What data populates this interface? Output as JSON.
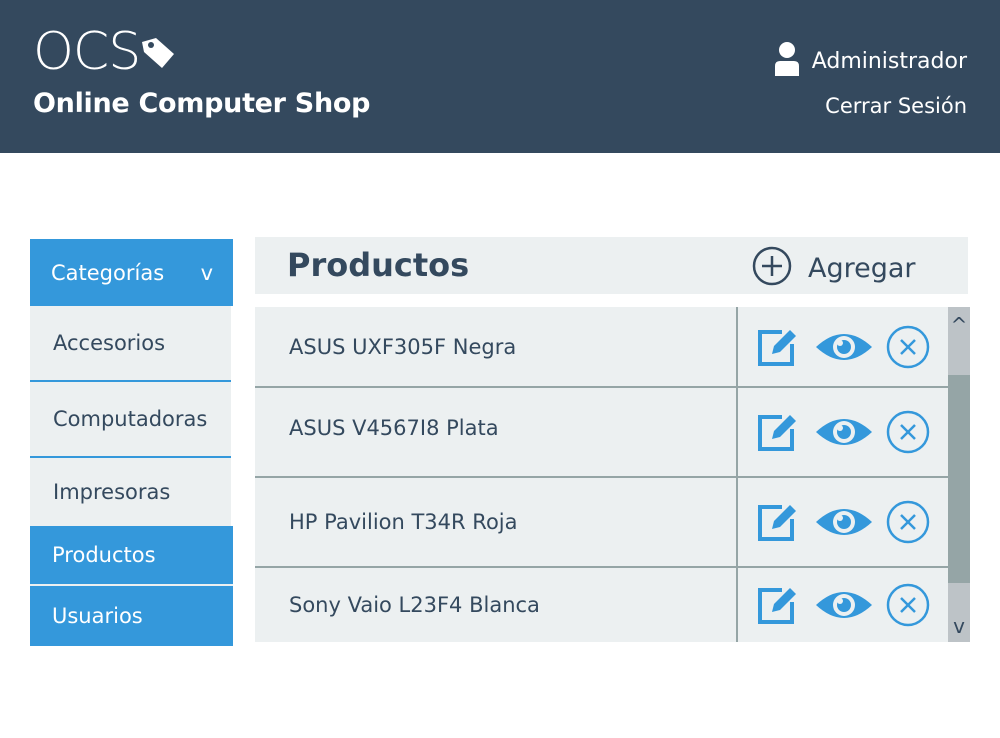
{
  "header": {
    "logo_text": "OCS",
    "shop_name": "Online Computer Shop",
    "user_name": "Administrador",
    "logout_label": "Cerrar Sesión",
    "background": "#34495e"
  },
  "sidebar": {
    "header_label": "Categorías",
    "toggle_glyph": "v",
    "items": [
      {
        "label": "Accesorios",
        "active": false
      },
      {
        "label": "Computadoras",
        "active": false
      },
      {
        "label": "Impresoras",
        "active": false
      },
      {
        "label": "Productos",
        "active": true
      },
      {
        "label": "Usuarios",
        "active": true
      }
    ]
  },
  "content": {
    "title": "Productos",
    "add_label": "Agregar"
  },
  "products": [
    {
      "name": "ASUS UXF305F Negra"
    },
    {
      "name": "ASUS V4567I8 Plata"
    },
    {
      "name": "HP Pavilion T34R Roja"
    },
    {
      "name": "Sony Vaio L23F4 Blanca"
    }
  ],
  "scrollbar": {
    "up_glyph": "^",
    "down_glyph": "v"
  },
  "colors": {
    "accent": "#3498db",
    "dark": "#34495e",
    "light": "#ecf0f1",
    "divider": "#95a5a6"
  },
  "icons": {
    "logo_tag": "price-tag-icon",
    "user": "user-icon",
    "add": "plus-circle-icon",
    "edit": "edit-icon",
    "view": "eye-icon",
    "delete": "close-circle-icon"
  }
}
